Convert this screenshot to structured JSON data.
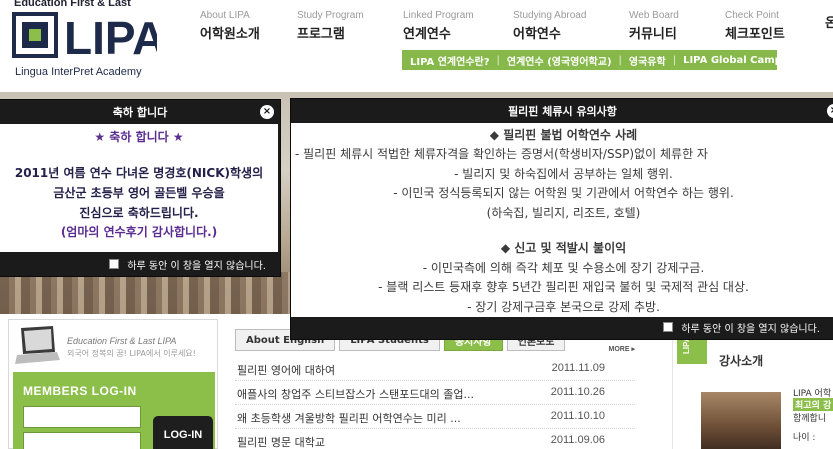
{
  "header": {
    "logo_tagline": "Education First & Last",
    "logo_text": "LIPA",
    "logo_subtitle": "Lingua InterPret Academy"
  },
  "gnb": [
    {
      "en": "About LIPA",
      "ko": "어학원소개"
    },
    {
      "en": "Study Program",
      "ko": "프로그램"
    },
    {
      "en": "Linked Program",
      "ko": "연계연수"
    },
    {
      "en": "Studying Abroad",
      "ko": "어학연수"
    },
    {
      "en": "Web Board",
      "ko": "커뮤니티"
    },
    {
      "en": "Check Point",
      "ko": "체크포인트"
    },
    {
      "en": "",
      "ko": "온"
    }
  ],
  "subnav": [
    "LIPA 연계연수란?",
    "연계연수 (영국영어학교)",
    "영국유학",
    "LIPA Global Camp"
  ],
  "popup1": {
    "title": "축하 합니다",
    "close": "×",
    "lines": [
      "★ 축하 합니다 ★",
      "2011년 여름 연수 다녀온 명경호(NICK)학생의",
      "금산군 초등부 영어 골든벨 우승을",
      "진심으로 축하드립니다.",
      "(엄마의 연수후기 감사합니다.)"
    ],
    "footer": "하루 동안 이 창을 열지 않습니다."
  },
  "popup2": {
    "title": "필리핀 체류시 유의사항",
    "close": "×",
    "lines": [
      "◆ 필리핀 불법 어학연수 사례",
      "- 필리핀 체류시 적법한 체류자격을 확인하는 증명서(학생비자/SSP)없이 체류한 자",
      "- 빌리지 및 하숙집에서 공부하는 일체 행위.",
      "- 이민국 정식등록되지 않는 어학원 및 기관에서 어학연수 하는 행위.",
      "(하숙집, 빌리지, 리조트, 호텔)",
      "",
      "◆ 신고 및 적발시 불이익",
      "- 이민국측에 의해 즉각 체포 및 수용소에 장기 강제구금.",
      "- 블랙 리스트 등재후 향후 5년간 필리핀 재입국 불허 및 국제적 관심 대상.",
      "- 장기 강제구금후 본국으로 강제 추방."
    ],
    "footer": "하루 동안 이 창을 열지 않습니다."
  },
  "members": {
    "edu": "Education First & Last LIPA",
    "edu_sub": "외국어 정복의 꿈! LIPA에서 이루세요!",
    "title": "MEMBERS LOG-IN",
    "login_button": "LOG-IN",
    "id_value": "",
    "pw_value": ""
  },
  "news": {
    "tabs": [
      "About English",
      "LIPA Students",
      "공지사항",
      "언론보도"
    ],
    "active_tab": 2,
    "more": "MORE ▸",
    "items": [
      {
        "title": "필리핀 영어에 대하여",
        "date": "2011.11.09"
      },
      {
        "title": "애플사의 창업주 스티브잡스가 스탠포드대의 졸업...",
        "date": "2011.10.26"
      },
      {
        "title": "왜 초등학생 겨울방학 필리핀 어학연수는 미리 ...",
        "date": "2011.10.10"
      },
      {
        "title": "필리핀 명문 대학교",
        "date": "2011.09.06"
      }
    ]
  },
  "teacher": {
    "ribbon": "LIPA",
    "title": "강사소개",
    "line1": "LIPA 어학",
    "line2": "최고의 강",
    "line3": "함께합니",
    "line4": "나이 :"
  },
  "colors": {
    "accent_green": "#8cbf4a",
    "logo_navy": "#1e2a4a",
    "popup_bar": "#1b1b1b",
    "popup1_text": "#5b2d91"
  }
}
